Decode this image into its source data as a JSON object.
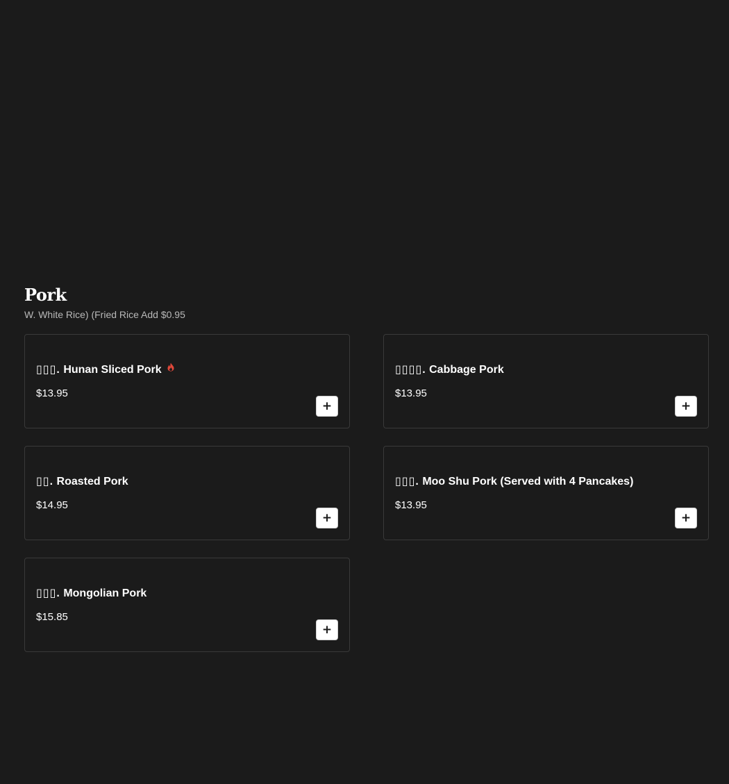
{
  "section": {
    "title": "Pork",
    "subtitle": "W. White Rice) (Fried Rice Add $0.95"
  },
  "items": [
    {
      "number": "▯▯▯.",
      "name": "Hunan Sliced Pork",
      "price": "$13.95",
      "spicy": true,
      "add_icon": "+"
    },
    {
      "number": "▯▯▯▯.",
      "name": "Cabbage Pork",
      "price": "$13.95",
      "spicy": false,
      "add_icon": "+"
    },
    {
      "number": "▯▯.",
      "name": "Roasted Pork",
      "price": "$14.95",
      "spicy": false,
      "add_icon": "+"
    },
    {
      "number": "▯▯▯.",
      "name": "Moo Shu Pork (Served with 4 Pancakes)",
      "price": "$13.95",
      "spicy": false,
      "add_icon": "+"
    },
    {
      "number": "▯▯▯.",
      "name": "Mongolian Pork",
      "price": "$15.85",
      "spicy": false,
      "add_icon": "+"
    }
  ],
  "colors": {
    "background": "#1b1b1b",
    "card_border": "#3a3a3a",
    "subtitle": "#b9b9b9",
    "spicy": "#e0483a",
    "button_bg": "#ffffff"
  }
}
